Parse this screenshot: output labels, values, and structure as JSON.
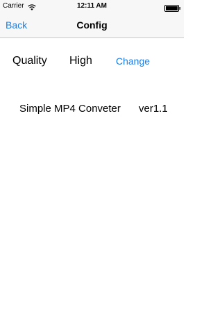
{
  "status_bar": {
    "carrier": "Carrier",
    "wifi_icon": "wifi-icon",
    "time": "12:11 AM",
    "battery_icon": "battery-full-icon"
  },
  "nav": {
    "back_label": "Back",
    "title": "Config"
  },
  "settings": {
    "quality_label": "Quality",
    "quality_value": "High",
    "change_label": "Change"
  },
  "about": {
    "app_name": "Simple MP4 Conveter",
    "version": "ver1.1"
  },
  "colors": {
    "accent": "#1a7ee6",
    "bar_background": "#f7f7f7"
  }
}
